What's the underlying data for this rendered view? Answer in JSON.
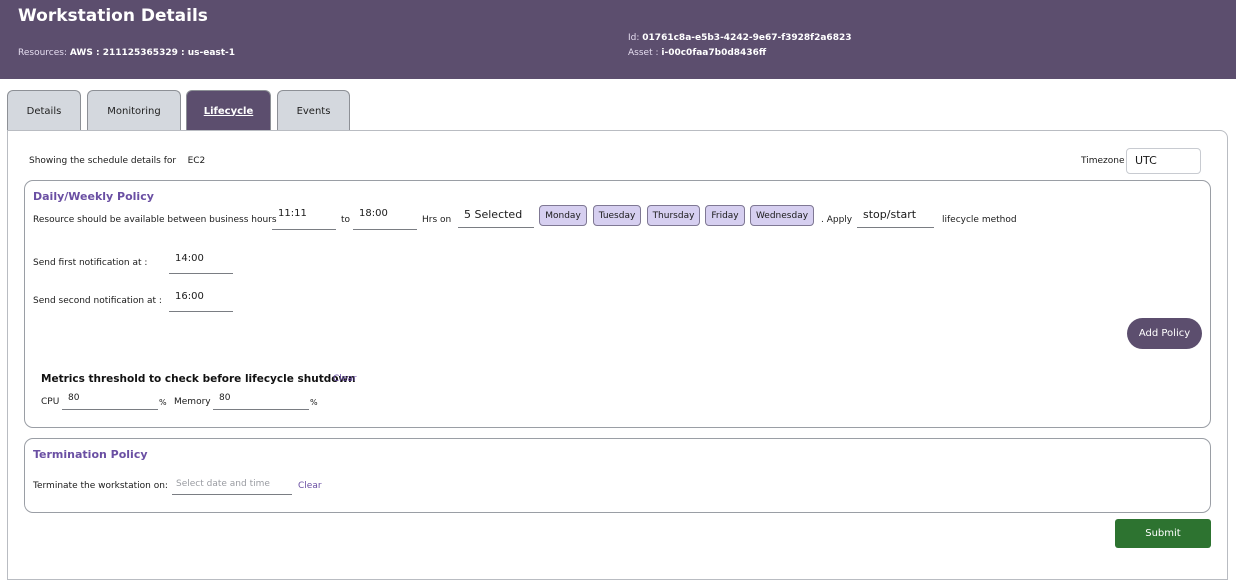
{
  "header": {
    "title": "Workstation Details",
    "resources_label": "Resources:",
    "resources_value": "AWS : 211125365329 : us-east-1",
    "id_label": "Id:",
    "id_value": "01761c8a-e5b3-4242-9e67-f3928f2a6823",
    "asset_label": "Asset :",
    "asset_value": "i-00c0faa7b0d8436ff"
  },
  "tabs": [
    {
      "label": "Details",
      "active": false
    },
    {
      "label": "Monitoring",
      "active": false
    },
    {
      "label": "Lifecycle",
      "active": true
    },
    {
      "label": "Events",
      "active": false
    }
  ],
  "lifecycle": {
    "showing_label": "Showing the schedule details for",
    "resource_type": "EC2",
    "timezone_label": "Timezone",
    "timezone_value": "UTC",
    "daily_policy": {
      "title": "Daily/Weekly Policy",
      "available_label": "Resource should be available between business hours",
      "start_time": "11:11",
      "to_label": "to",
      "end_time": "18:00",
      "hrs_on_label": "Hrs on",
      "days_selected": "5 Selected",
      "days": [
        "Monday",
        "Tuesday",
        "Thursday",
        "Friday",
        "Wednesday"
      ],
      "apply_label": ". Apply",
      "method_value": "stop/start",
      "method_label": "lifecycle method",
      "first_notification_label": "Send first notification at :",
      "first_notification_value": "14:00",
      "second_notification_label": "Send second notification at :",
      "second_notification_value": "16:00",
      "add_policy_label": "Add Policy",
      "metrics_title": "Metrics threshold to check before lifecycle shutdown",
      "clear_label": "Clear",
      "cpu_label": "CPU",
      "cpu_value": "80",
      "memory_label": "Memory",
      "memory_value": "80",
      "percent": "%"
    },
    "termination_policy": {
      "title": "Termination Policy",
      "terminate_label": "Terminate the workstation on:",
      "date_placeholder": "Select date and time",
      "clear_label": "Clear"
    },
    "submit_label": "Submit"
  },
  "colors": {
    "header_bg": "#5c4e6e",
    "accent_purple": "#6a4fa3",
    "chip_bg": "#d6cff0",
    "submit_green": "#2d7330",
    "tab_bg": "#d4d8de"
  }
}
